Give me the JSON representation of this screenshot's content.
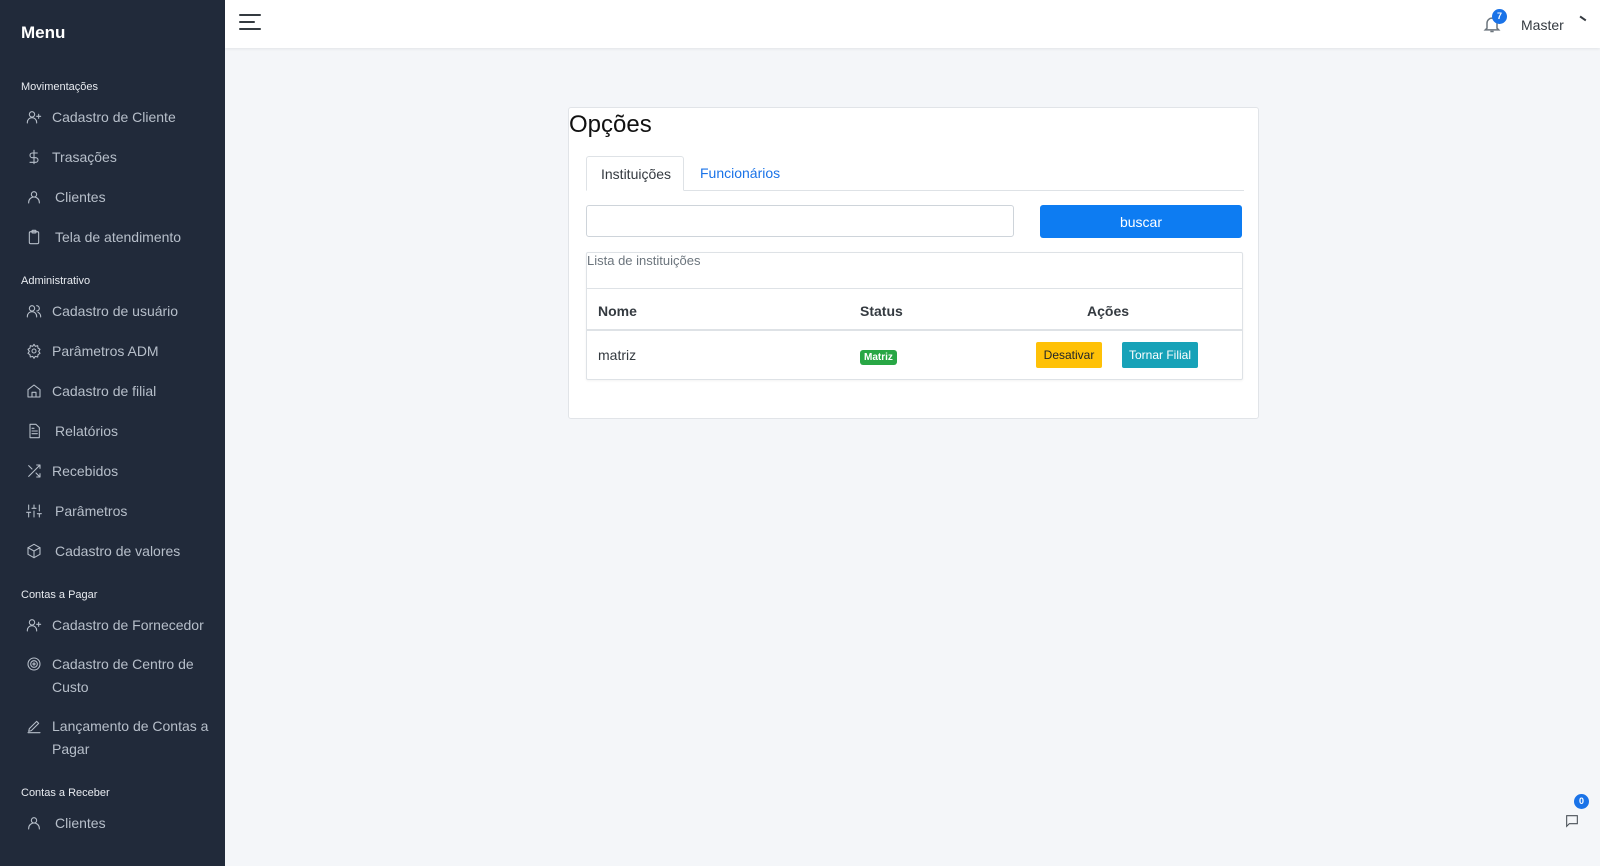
{
  "sidebar": {
    "title": "Menu",
    "sections": [
      {
        "label": "Movimentações",
        "items": [
          {
            "label": "Cadastro de Cliente",
            "icon": "user-plus-icon"
          },
          {
            "label": "Trasações",
            "icon": "dollar-icon"
          },
          {
            "label": "Clientes",
            "icon": "user-icon"
          },
          {
            "label": "Tela de atendimento",
            "icon": "clipboard-icon"
          }
        ]
      },
      {
        "label": "Administrativo",
        "items": [
          {
            "label": "Cadastro de usuário",
            "icon": "users-icon"
          },
          {
            "label": "Parâmetros ADM",
            "icon": "gear-icon"
          },
          {
            "label": "Cadastro de filial",
            "icon": "home-icon"
          },
          {
            "label": "Relatórios",
            "icon": "file-text-icon"
          },
          {
            "label": "Recebidos",
            "icon": "shuffle-icon"
          },
          {
            "label": "Parâmetros",
            "icon": "sliders-icon"
          },
          {
            "label": "Cadastro de valores",
            "icon": "box-icon"
          }
        ]
      },
      {
        "label": "Contas a Pagar",
        "items": [
          {
            "label": "Cadastro de Fornecedor",
            "icon": "user-plus-icon"
          },
          {
            "label": "Cadastro de Centro de Custo",
            "icon": "target-icon"
          },
          {
            "label": "Lançamento de Contas a Pagar",
            "icon": "pen-icon"
          }
        ]
      },
      {
        "label": "Contas a Receber",
        "items": [
          {
            "label": "Clientes",
            "icon": "user-icon"
          }
        ]
      }
    ]
  },
  "topbar": {
    "notification_count": "7",
    "user_name": "Master"
  },
  "card": {
    "title": "Opções",
    "tabs": [
      {
        "label": "Instituições",
        "active": true
      },
      {
        "label": "Funcionários",
        "active": false
      }
    ],
    "search": {
      "value": "",
      "placeholder": "",
      "button_label": "buscar"
    },
    "list": {
      "caption": "Lista de instituições",
      "columns": [
        "Nome",
        "Status",
        "Ações"
      ],
      "rows": [
        {
          "nome": "matriz",
          "status": "Matriz",
          "actions": [
            "Desativar",
            "Tornar Filial"
          ]
        }
      ]
    }
  },
  "chat": {
    "count": "0"
  },
  "colors": {
    "sidebar_bg": "#212a3a",
    "primary": "#0d7cf2",
    "warning": "#ffc107",
    "info": "#17a2b8",
    "success": "#28a745"
  }
}
